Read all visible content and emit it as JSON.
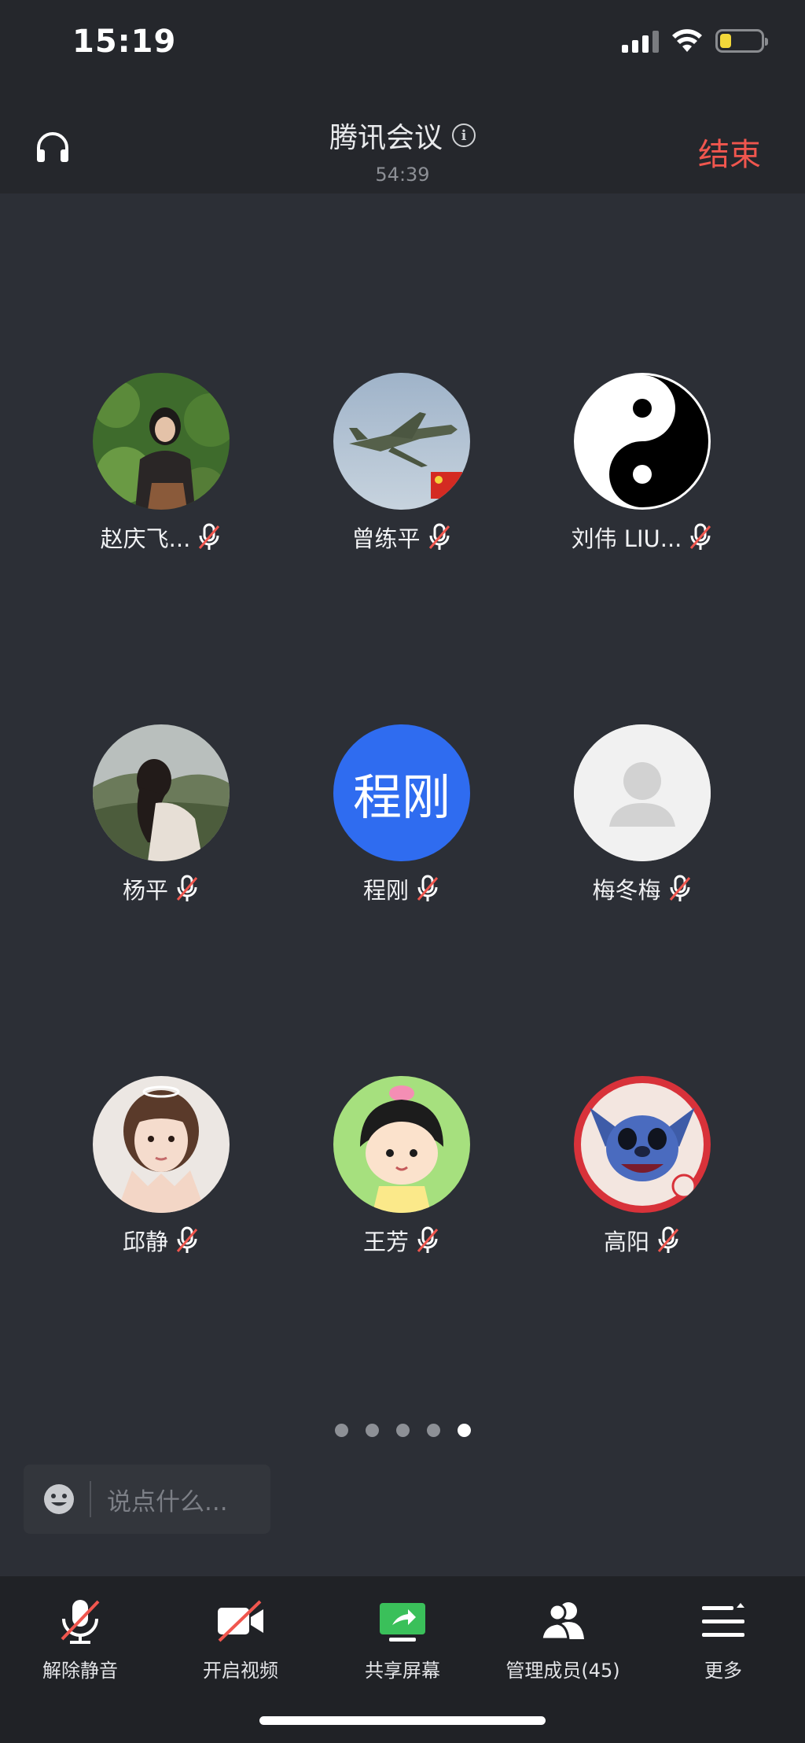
{
  "status_bar": {
    "time": "15:19"
  },
  "header": {
    "title": "腾讯会议",
    "timer": "54:39",
    "end_label": "结束"
  },
  "participants": [
    {
      "name": "赵庆飞...",
      "avatar": "photo-woman-in-garden",
      "muted": true
    },
    {
      "name": "曾练平",
      "avatar": "photo-fighter-jet",
      "muted": true
    },
    {
      "name": "刘伟 LIU...",
      "avatar": "yin-yang-symbol",
      "muted": true
    },
    {
      "name": "杨平",
      "avatar": "photo-woman-mountain",
      "muted": true
    },
    {
      "name": "程刚",
      "avatar_text": "程刚",
      "avatar": "text-avatar",
      "muted": true
    },
    {
      "name": "梅冬梅",
      "avatar": "default-person",
      "muted": true
    },
    {
      "name": "邱静",
      "avatar": "photo-girl-selfie",
      "muted": true
    },
    {
      "name": "王芳",
      "avatar": "cartoon-girl",
      "muted": true
    },
    {
      "name": "高阳",
      "avatar": "cartoon-stitch",
      "muted": true
    }
  ],
  "pager": {
    "total": 5,
    "current": 5
  },
  "chat": {
    "placeholder": "说点什么..."
  },
  "toolbar": {
    "unmute": "解除静音",
    "start_video": "开启视频",
    "share_screen": "共享屏幕",
    "manage_members": "管理成员(45)",
    "more": "更多"
  },
  "colors": {
    "background": "#2c2f36",
    "end_red": "#f0564e",
    "text_avatar_blue": "#2f6cf0",
    "share_green": "#3ac05a"
  }
}
